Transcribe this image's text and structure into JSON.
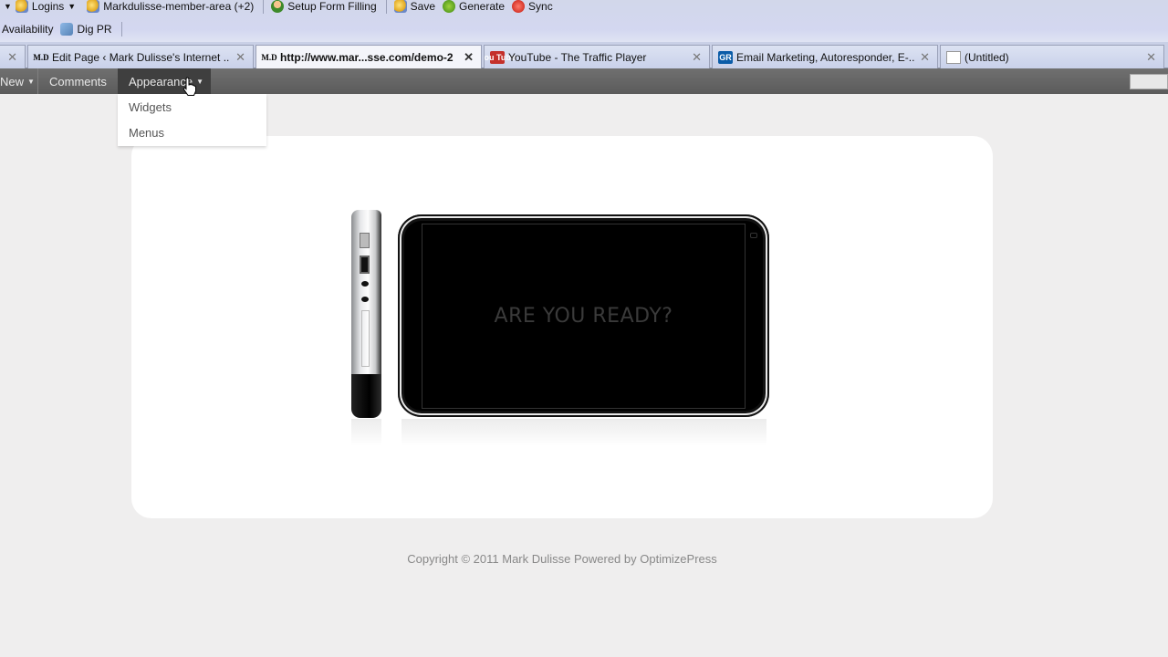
{
  "toolbar": {
    "row1": [
      {
        "label": "Logins",
        "icon": "star-key-icon",
        "dropdown": true
      },
      {
        "label": "Markdulisse-member-area (+2)",
        "icon": "star-key-icon"
      },
      {
        "label": "Setup Form Filling",
        "icon": "user-icon"
      },
      {
        "label": "Save",
        "icon": "star-key-icon"
      },
      {
        "label": "Generate",
        "icon": "lightning-icon"
      },
      {
        "label": "Sync",
        "icon": "sync-icon"
      }
    ],
    "row2": [
      {
        "label": "Availability"
      },
      {
        "label": "Dig PR",
        "icon": "network-icon"
      }
    ]
  },
  "tabs": [
    {
      "title": "",
      "partial": true
    },
    {
      "title": "Edit Page ‹ Mark Dulisse's Internet ...",
      "favicon": "M.D"
    },
    {
      "title": "http://www.mar...sse.com/demo-2",
      "favicon": "M.D",
      "active": true
    },
    {
      "title": "YouTube - The Traffic Player",
      "favicon": "You Tube"
    },
    {
      "title": "Email Marketing, Autoresponder, E-...",
      "favicon": "GR"
    },
    {
      "title": "(Untitled)",
      "favicon": "doc"
    }
  ],
  "adminbar": {
    "items": [
      {
        "label": "New",
        "dropdown": true
      },
      {
        "label": "Comments"
      },
      {
        "label": "Appearance",
        "dropdown": true,
        "open": true
      }
    ],
    "appearance_menu": [
      "Widgets",
      "Menus"
    ]
  },
  "content": {
    "screen_text": "ARE YOU READY?"
  },
  "footer": {
    "text": "Copyright © 2011 Mark Dulisse Powered by OptimizePress"
  },
  "glyphs": {
    "caret": "▼",
    "close": "✕"
  }
}
